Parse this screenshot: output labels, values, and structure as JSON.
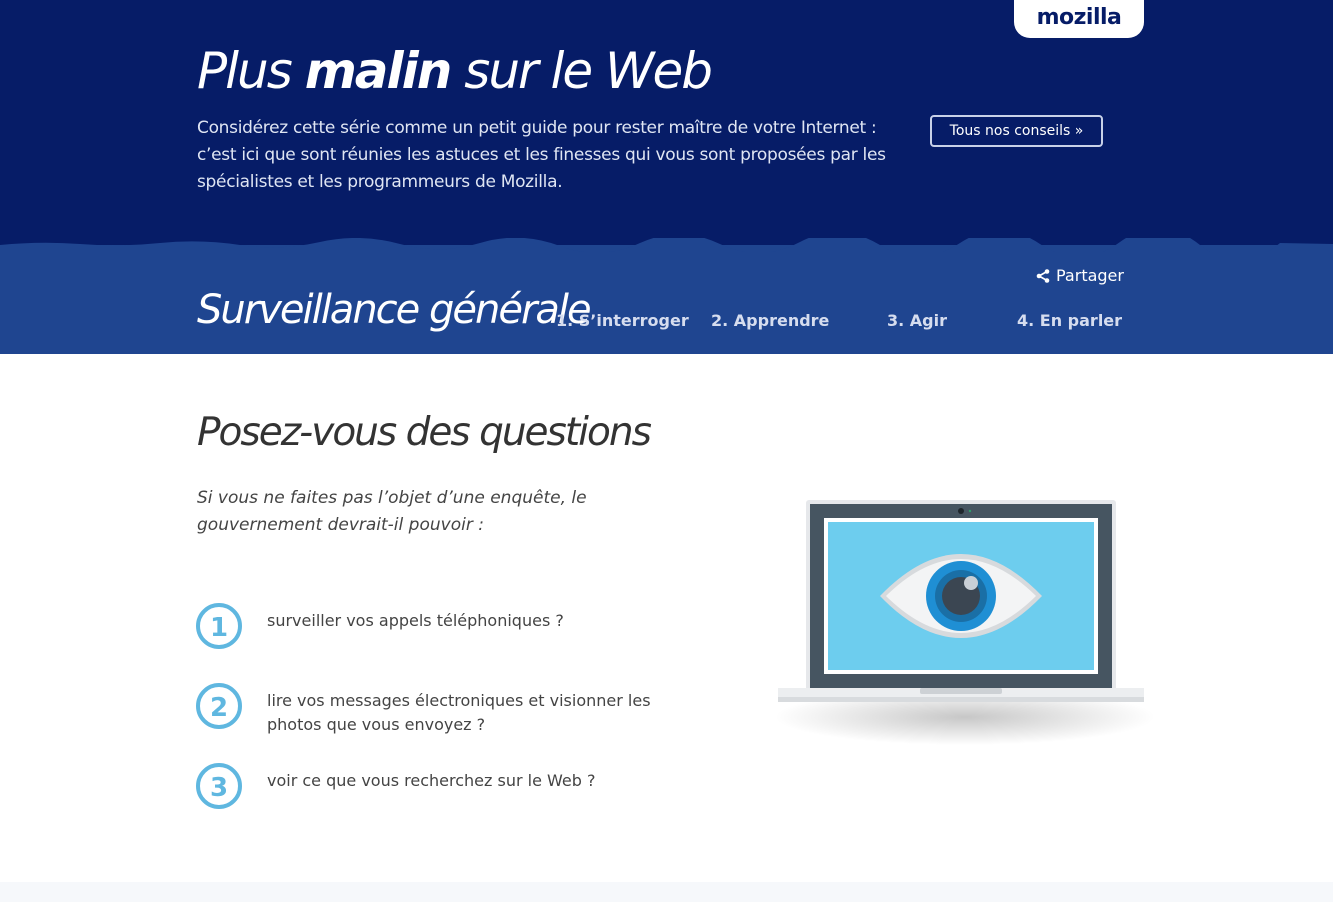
{
  "brand": {
    "logo_text": "mozilla"
  },
  "hero": {
    "title_pre": "Plus ",
    "title_bold": "malin",
    "title_post": " sur le Web",
    "description": "Considérez cette série comme un petit guide pour rester maître de votre Internet : c’est ici que sont réunies les astuces et les finesses qui vous sont proposées par les spécialistes et les programmeurs de Mozilla.",
    "all_tips_button": "Tous nos conseils »"
  },
  "topic": {
    "title": "Surveillance générale",
    "share_label": "Partager",
    "steps": [
      "1. S’interroger",
      "2. Apprendre",
      "3. Agir",
      "4. En parler"
    ]
  },
  "content": {
    "section_title": "Posez-vous des questions",
    "intro": "Si vous ne faites pas l’objet d’une enquête, le gouvernement devrait-il pouvoir :",
    "questions": [
      {
        "number": "1",
        "text": "surveiller vos appels téléphoniques ?"
      },
      {
        "number": "2",
        "text": "lire vos messages électroniques et visionner les photos que vous envoyez ?"
      },
      {
        "number": "3",
        "text": "voir ce que vous recherchez sur le Web ?"
      }
    ]
  },
  "icons": {
    "share": "share-icon",
    "illustration": "laptop-eye-illustration"
  },
  "colors": {
    "header_bg": "#061c67",
    "topic_bar_bg": "#1f4590",
    "number_circle": "#5fb7e0",
    "screen": "#6dcdee"
  }
}
